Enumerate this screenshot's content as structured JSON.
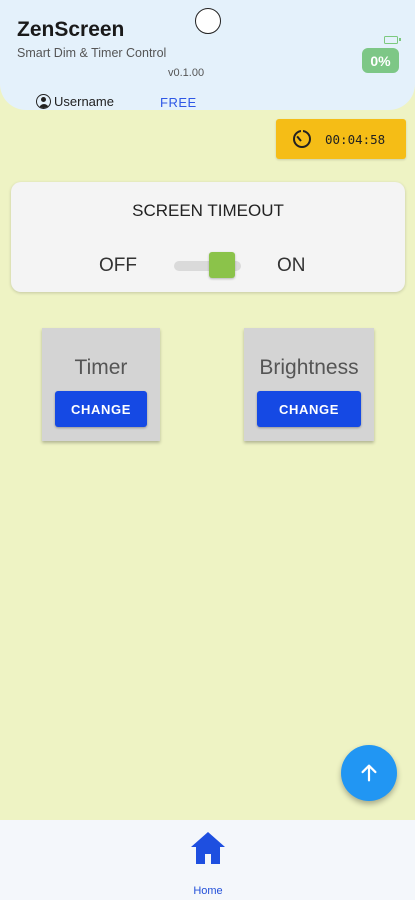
{
  "header": {
    "title": "ZenScreen",
    "subtitle": "Smart Dim & Timer Control",
    "version": "v0.1.00",
    "battery_percent": "0%",
    "username": "Username",
    "plan": "FREE"
  },
  "timer_chip": {
    "time": "00:04:58",
    "icon": "timer-icon"
  },
  "screen_timeout": {
    "title": "SCREEN TIMEOUT",
    "off_label": "OFF",
    "on_label": "ON",
    "state": "on"
  },
  "controls": [
    {
      "title": "Timer",
      "button_label": "CHANGE"
    },
    {
      "title": "Brightness",
      "button_label": "CHANGE"
    }
  ],
  "fab": {
    "icon": "arrow-up-icon"
  },
  "nav": {
    "items": [
      {
        "label": "Home",
        "icon": "home-icon"
      }
    ]
  },
  "colors": {
    "background": "#eef3c4",
    "header": "#e4f1fb",
    "timer_chip": "#f5bd16",
    "toggle_on": "#8bc34a",
    "button": "#1549e4",
    "fab": "#2196f3",
    "battery": "#7dc786"
  }
}
